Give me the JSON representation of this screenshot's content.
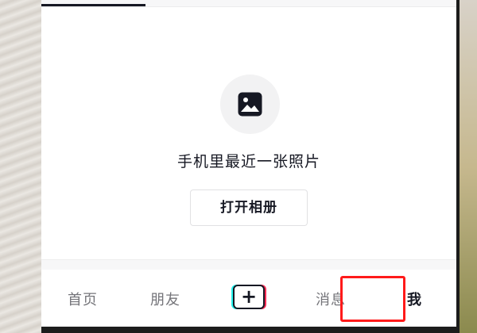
{
  "empty_state": {
    "icon": "image-icon",
    "prompt": "手机里最近一张照片",
    "open_album_label": "打开相册"
  },
  "bottom_nav": {
    "items": [
      {
        "label": "首页",
        "active": false
      },
      {
        "label": "朋友",
        "active": false
      },
      {
        "label": "+",
        "active": false,
        "icon": "create-plus-icon"
      },
      {
        "label": "消息",
        "active": false
      },
      {
        "label": "我",
        "active": true
      }
    ]
  },
  "colors": {
    "highlight": "#ff1a1a",
    "text_primary": "#161823",
    "text_secondary": "#747479",
    "accent_cyan": "#25f4ee",
    "accent_red": "#fe2c55"
  }
}
